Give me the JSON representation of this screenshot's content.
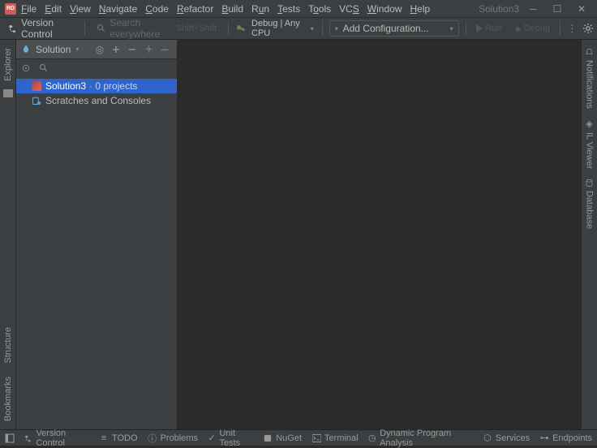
{
  "app_icon": "RD",
  "menu": [
    "File",
    "Edit",
    "View",
    "Navigate",
    "Code",
    "Refactor",
    "Build",
    "Run",
    "Tests",
    "Tools",
    "VCS",
    "Window",
    "Help"
  ],
  "title": "Solution3",
  "toolbar": {
    "vc": "Version Control",
    "search_placeholder": "Search everywhere",
    "shortcut": "Shift+Shift",
    "debug_label": "Debug | Any CPU",
    "config_placeholder": "Add Configuration...",
    "run_label": "Run",
    "debug_btn": "Debug"
  },
  "left_rail": {
    "explorer": "Explorer",
    "structure": "Structure",
    "bookmarks": "Bookmarks"
  },
  "right_rail": {
    "notifications": "Notifications",
    "il_viewer": "IL Viewer",
    "database": "Database"
  },
  "explorer": {
    "header": "Solution",
    "tree": {
      "sln_name": "Solution3",
      "sln_sub": "· 0 projects",
      "scratches": "Scratches and Consoles"
    }
  },
  "status": {
    "vc": "Version Control",
    "todo": "TODO",
    "problems": "Problems",
    "unit": "Unit Tests",
    "nuget": "NuGet",
    "terminal": "Terminal",
    "dpa": "Dynamic Program Analysis",
    "services": "Services",
    "endpoints": "Endpoints"
  }
}
